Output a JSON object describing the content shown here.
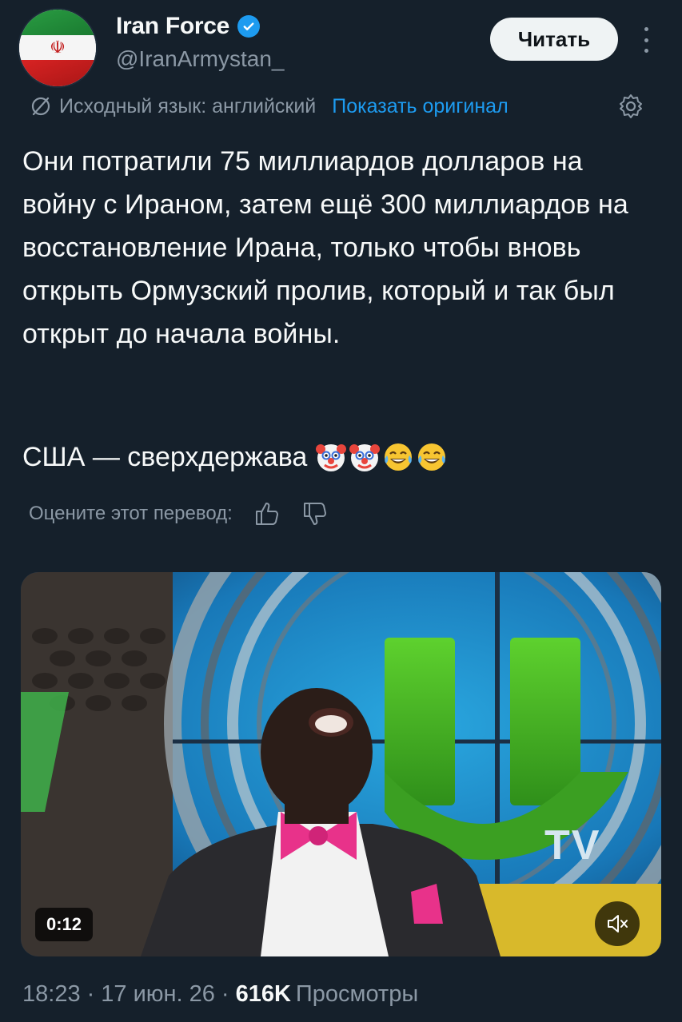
{
  "author": {
    "display_name": "Iran Force",
    "handle": "@IranArmystan_",
    "verified": true,
    "avatar_icon": "iran-flag-avatar"
  },
  "follow_button": {
    "label": "Читать"
  },
  "translation": {
    "source_label": "Исходный язык: английский",
    "show_original": "Показать оригинал"
  },
  "tweet": {
    "text": "Они потратили 75 миллиардов долларов на войну с Ираном, затем ещё 300 миллиардов на восстановление Ирана, только чтобы вновь открыть Ормузский пролив, который и так был открыт до начала войны.",
    "second_line": "США — сверхдержава",
    "emojis": [
      "clown-face",
      "clown-face",
      "tears-of-joy",
      "tears-of-joy"
    ]
  },
  "rating": {
    "label": "Оцените этот перевод:"
  },
  "video": {
    "duration": "0:12",
    "muted": true,
    "logo_text": "TV"
  },
  "meta": {
    "time": "18:23",
    "date": "17 июн. 26",
    "views": "616K",
    "views_label": "Просмотры"
  },
  "colors": {
    "background": "#15202b",
    "accent": "#1d9bf0",
    "muted_text": "#8b98a5"
  }
}
